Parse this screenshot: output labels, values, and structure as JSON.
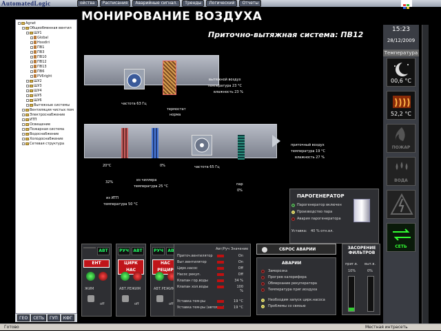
{
  "app": {
    "logo": "AutomatedLogic",
    "title": "МОНИРОВАНИЕ ВОЗДУХА",
    "subtitle": "Приточно-вытяжная система: ПВ12"
  },
  "menus": [
    "ойства",
    "Расписания",
    "Аварийные сигнал.",
    "Тренды",
    "Логический",
    "Отчеты"
  ],
  "clock": {
    "time": "15:23",
    "date": "28/12/2009",
    "temp_label": "Температура",
    "temp_night": "00,6 °C",
    "temp_heat": "52,2 °C"
  },
  "status_icons": [
    {
      "icon": "moon-icon",
      "label": ""
    },
    {
      "icon": "heat-icon",
      "label": ""
    },
    {
      "icon": "fire-icon",
      "label": "ПОЖАР"
    },
    {
      "icon": "water-icon",
      "label": "ВОДА"
    },
    {
      "icon": "lightning-icon",
      "label": ""
    },
    {
      "icon": "network-icon",
      "label": "СЕТЬ"
    }
  ],
  "tree": {
    "nodes": [
      {
        "text": "Agnet",
        "indent": 0,
        "kind": "fold"
      },
      {
        "text": "Общеобменная вентил",
        "indent": 1,
        "kind": "fold"
      },
      {
        "text": "ШУ1",
        "indent": 2,
        "kind": "fold"
      },
      {
        "text": "Global",
        "indent": 3,
        "kind": "file"
      },
      {
        "text": "Hoodiri",
        "indent": 3,
        "kind": "file"
      },
      {
        "text": "ПВ1",
        "indent": 3,
        "kind": "file"
      },
      {
        "text": "ПВ3",
        "indent": 3,
        "kind": "file"
      },
      {
        "text": "ПВ10",
        "indent": 3,
        "kind": "file"
      },
      {
        "text": "ПВ12",
        "indent": 3,
        "kind": "file"
      },
      {
        "text": "ПВ13",
        "indent": 3,
        "kind": "file"
      },
      {
        "text": "ПВ6",
        "indent": 3,
        "kind": "file"
      },
      {
        "text": "PV6right",
        "indent": 3,
        "kind": "file"
      },
      {
        "text": "ШУ2",
        "indent": 2,
        "kind": "fold"
      },
      {
        "text": "ШУ3",
        "indent": 2,
        "kind": "fold"
      },
      {
        "text": "ШУ4",
        "indent": 2,
        "kind": "fold"
      },
      {
        "text": "ШУ5",
        "indent": 2,
        "kind": "fold"
      },
      {
        "text": "ШУ6",
        "indent": 2,
        "kind": "fold"
      },
      {
        "text": "Вытяжные системы",
        "indent": 2,
        "kind": "fold"
      },
      {
        "text": "Вентиляция чистых пом",
        "indent": 1,
        "kind": "fold"
      },
      {
        "text": "Электроснабжение",
        "indent": 1,
        "kind": "fold"
      },
      {
        "text": "ИТП",
        "indent": 1,
        "kind": "fold"
      },
      {
        "text": "Освещение",
        "indent": 1,
        "kind": "fold"
      },
      {
        "text": "Пожарная система",
        "indent": 1,
        "kind": "fold"
      },
      {
        "text": "Водоснабжение",
        "indent": 1,
        "kind": "fold"
      },
      {
        "text": "Холодоснабжение",
        "indent": 1,
        "kind": "fold"
      },
      {
        "text": "Сетевая структура",
        "indent": 1,
        "kind": "fold"
      }
    ]
  },
  "bottom_tabs": [
    "ГЕО",
    "СЕТЬ",
    "ГУП",
    "КФГ"
  ],
  "status": {
    "left": "Готово",
    "right": "Местная интрасеть"
  },
  "diagram": {
    "exhaust_fan_speed": "частота 63 Гц",
    "supply_fan_speed": "частота 65 Гц",
    "thermostat": "термостат",
    "thermostat_state": "норма",
    "exhaust_air": "вытяжной воздух",
    "exhaust_temp": "температура  23  °C",
    "exhaust_hum": "влажность  23  %",
    "supply_air": "приточный воздух",
    "supply_temp": "температура  19  °C",
    "supply_hum": "влажность  27  %",
    "valve_temp": "20°C",
    "valve_pct": "32%",
    "from_itp": "из ИТП",
    "itp_temp": "температура  50  °C",
    "chiller_pct": "0%",
    "from_chiller": "из чиллера",
    "chiller_temp": "температура  25  °C",
    "steam": "пар",
    "steam_pct": "0%"
  },
  "steam_gen": {
    "title": "ПАРОГЕНЕРАТОР",
    "rows": [
      "Парогенератор включен",
      "Производство пара",
      "Авария парогенератора"
    ],
    "setpoint_label": "Уставка:",
    "setpoint": "40 % отн.вл."
  },
  "control_panels": [
    {
      "auto": "АВТ",
      "manual": "",
      "name": "ЕНТ",
      "mode": "ЖИМ",
      "off": "off"
    },
    {
      "auto": "АВТ",
      "manual": "РУЧ",
      "name": "ЦИРК НАС",
      "mode": "АВТ.РЕЖИМ",
      "off": "off"
    },
    {
      "auto": "АВТ",
      "manual": "РУЧ",
      "name": "НАС РЕЦИР",
      "mode": "АВТ.РЕЖИМ",
      "off": "off"
    }
  ],
  "params": {
    "header_auto": "Авт/Руч",
    "header_value": "Значение",
    "rows": [
      {
        "label": "Приточ.вентилятор",
        "value": "On"
      },
      {
        "label": "Выт.вентилятор",
        "value": "On"
      },
      {
        "label": "Цирк.насос",
        "value": "Off"
      },
      {
        "label": "Насос рекуп.",
        "value": "Off"
      },
      {
        "label": "Клапан гор.воды",
        "value": "34 %"
      },
      {
        "label": "Клапан хол.воды",
        "value": "100 %"
      }
    ],
    "setpoints": [
      {
        "label": "Уставка тем-ры",
        "value": "19 °C"
      },
      {
        "label": "Уставка тем-ры (автомат)",
        "value": "19 °C"
      }
    ]
  },
  "alarms": {
    "reset_button": "СБРОС АВАРИИ",
    "title": "АВАРИИ",
    "rows": [
      "Заморозка",
      "Прогрев калорифера",
      "Обмерзание рекуператора",
      "Температура приг.воздуха"
    ],
    "notices": [
      "Необходим запуск цирк.насоса",
      "Проблемы со связью"
    ]
  },
  "filters": {
    "title": "ЗАСОРЕНИЕ ФИЛЬТРОВ",
    "col1": "приг.в.",
    "col2": "выт.в.",
    "val1": "10%",
    "val2": "0%"
  }
}
